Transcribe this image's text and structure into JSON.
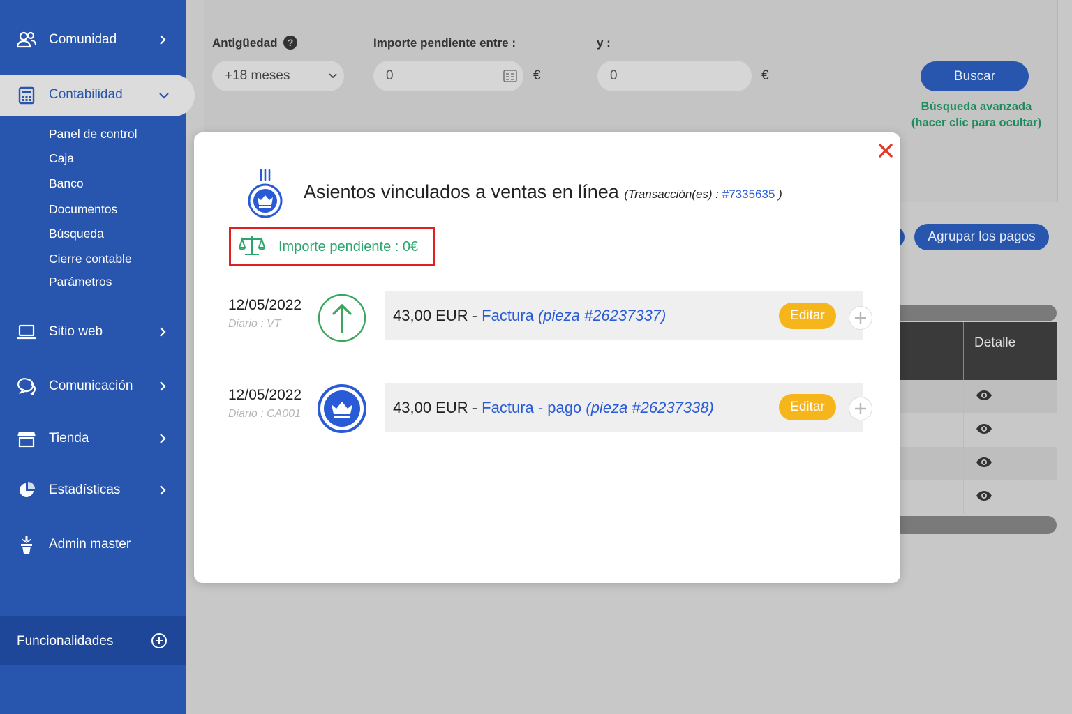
{
  "sidebar": {
    "items": [
      {
        "label": "Comunidad",
        "icon": "users-icon"
      },
      {
        "label": "Contabilidad",
        "icon": "calculator-icon"
      },
      {
        "label": "Sitio web",
        "icon": "laptop-icon"
      },
      {
        "label": "Comunicación",
        "icon": "chat-bubbles-icon"
      },
      {
        "label": "Tienda",
        "icon": "store-icon"
      },
      {
        "label": "Estadísticas",
        "icon": "pie-chart-icon"
      },
      {
        "label": "Admin master",
        "icon": "admin-icon"
      }
    ],
    "subitems": [
      "Panel de control",
      "Caja",
      "Banco",
      "Documentos",
      "Búsqueda",
      "Cierre contable",
      "Parámetros"
    ],
    "footer": {
      "label": "Funcionalidades"
    }
  },
  "filters": {
    "age_label": "Antigüedad",
    "age_value": "+18 meses",
    "amount_label": "Importe pendiente entre :",
    "amount_from": "0",
    "and_label": "y :",
    "amount_to": "0",
    "currency": "€",
    "search_button": "Buscar",
    "advanced_line1": "Búsqueda avanzada",
    "advanced_line2": "(hacer clic para ocultar)"
  },
  "actions": {
    "group_payments": "Agrupar los pagos"
  },
  "table": {
    "header_detail": "Detalle",
    "row_count": 4
  },
  "modal": {
    "title": "Asientos vinculados a ventas en línea",
    "meta_prefix": "(Transacción(es) : ",
    "transaction": "#7335635",
    "meta_suffix": " )",
    "pending": "Importe pendiente : 0€",
    "entries": [
      {
        "date": "12/05/2022",
        "diary": "Diario : VT",
        "amount": "43,00 EUR - ",
        "doc": "Factura",
        "piece": "(pieza #26237337)",
        "edit": "Editar",
        "icon": "arrow-up-circle-icon"
      },
      {
        "date": "12/05/2022",
        "diary": "Diario : CA001",
        "amount": "43,00 EUR - ",
        "doc": "Factura - pago",
        "piece": "(pieza #26237338)",
        "edit": "Editar",
        "icon": "crown-circle-icon"
      }
    ]
  },
  "colors": {
    "sidebar": "#2855ad",
    "accent_blue": "#2a5bd7",
    "success_green": "#2aa66d",
    "edit_yellow": "#f5b51b",
    "highlight_red": "#e02020"
  }
}
